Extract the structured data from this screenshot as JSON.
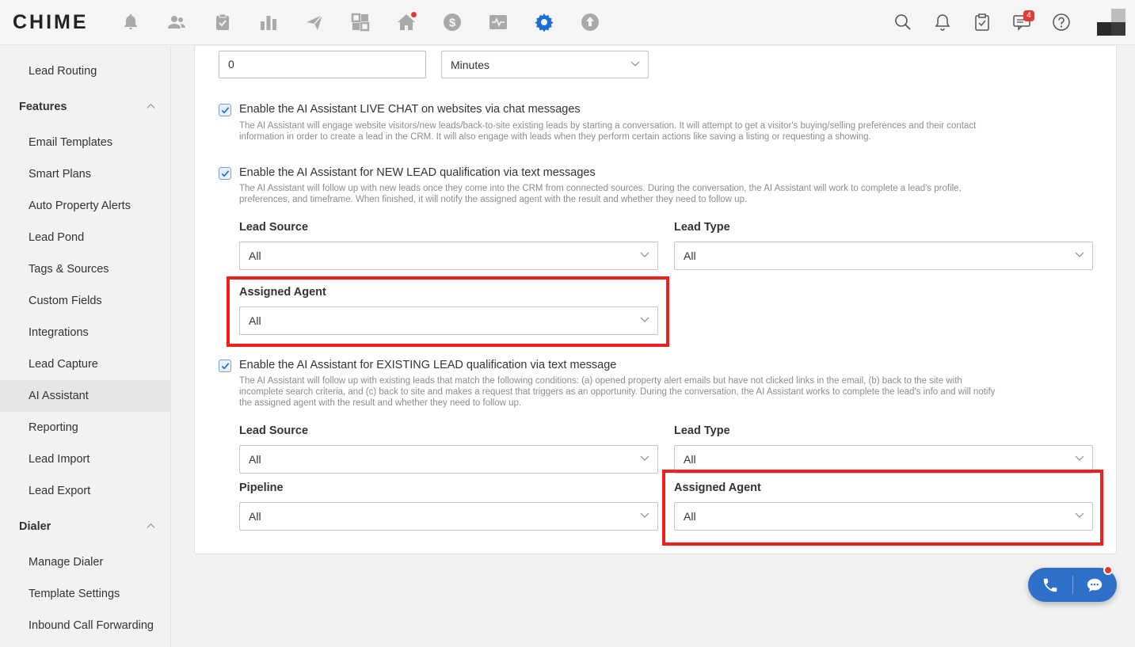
{
  "app": {
    "logo_text": "CHIME"
  },
  "topnav": {
    "icons": [
      "alert-bell-icon",
      "contacts-icon",
      "clipboard-check-icon",
      "bar-chart-icon",
      "send-icon",
      "dashboard-grid-icon",
      "home-icon",
      "dollar-icon",
      "activity-icon",
      "settings-gear-icon",
      "upload-icon"
    ],
    "active": "settings-gear-icon",
    "right_icons": [
      "search-icon",
      "notification-bell-icon",
      "task-clipboard-icon",
      "messages-icon",
      "help-icon"
    ],
    "messages_badge": "4"
  },
  "sidebar": {
    "items": [
      {
        "label": "Lead Routing"
      },
      {
        "label": "Features",
        "header": true
      },
      {
        "label": "Email Templates"
      },
      {
        "label": "Smart Plans"
      },
      {
        "label": "Auto Property Alerts"
      },
      {
        "label": "Lead Pond"
      },
      {
        "label": "Tags & Sources"
      },
      {
        "label": "Custom Fields"
      },
      {
        "label": "Integrations"
      },
      {
        "label": "Lead Capture"
      },
      {
        "label": "AI Assistant",
        "active": true
      },
      {
        "label": "Reporting"
      },
      {
        "label": "Lead Import"
      },
      {
        "label": "Lead Export"
      },
      {
        "label": "Dialer",
        "header": true
      },
      {
        "label": "Manage Dialer"
      },
      {
        "label": "Template Settings"
      },
      {
        "label": "Inbound Call Forwarding"
      }
    ]
  },
  "main": {
    "delay": {
      "value": "0",
      "unit": "Minutes"
    },
    "live_chat": {
      "checked": true,
      "label": "Enable the AI Assistant LIVE CHAT on websites via chat messages",
      "desc_1": "The AI Assistant will engage website visitors/new leads/back-to-site existing leads by starting a conversation. It will attempt to get a visitor's buying/selling preferences and their contact",
      "desc_2": "information in order to create a lead in the CRM. It will also engage with leads when they perform certain actions like saving a listing or requesting a showing."
    },
    "new_lead": {
      "checked": true,
      "label": "Enable the AI Assistant for NEW LEAD qualification via text messages",
      "desc_1": "The AI Assistant will follow up with new leads once they come into the CRM from connected sources. During the conversation, the AI Assistant will work to complete a lead's profile,",
      "desc_2": "preferences, and timeframe. When finished, it will notify the assigned agent with the result and whether they need to follow up.",
      "lead_source_label": "Lead Source",
      "lead_source_value": "All",
      "lead_type_label": "Lead Type",
      "lead_type_value": "All",
      "assigned_agent_label": "Assigned Agent",
      "assigned_agent_value": "All"
    },
    "existing_lead": {
      "checked": true,
      "label": "Enable the AI Assistant for EXISTING LEAD qualification via text message",
      "desc_1": "The AI Assistant will follow up with existing leads that match the following conditions: (a) opened property alert emails but have not clicked links in the email, (b) back to the site with",
      "desc_2": "incomplete search criteria, and (c) back to site and makes a request that triggers as an opportunity. During the conversation, the AI Assistant works to complete the lead's info and will notify",
      "desc_3": "the assigned agent with the result and whether they need to follow up.",
      "lead_source_label": "Lead Source",
      "lead_source_value": "All",
      "lead_type_label": "Lead Type",
      "lead_type_value": "All",
      "pipeline_label": "Pipeline",
      "pipeline_value": "All",
      "assigned_agent_label": "Assigned Agent",
      "assigned_agent_value": "All"
    }
  },
  "colors": {
    "highlight": "#ef1f1f",
    "accent": "#1a6fd6",
    "fab": "#2e6fca"
  }
}
